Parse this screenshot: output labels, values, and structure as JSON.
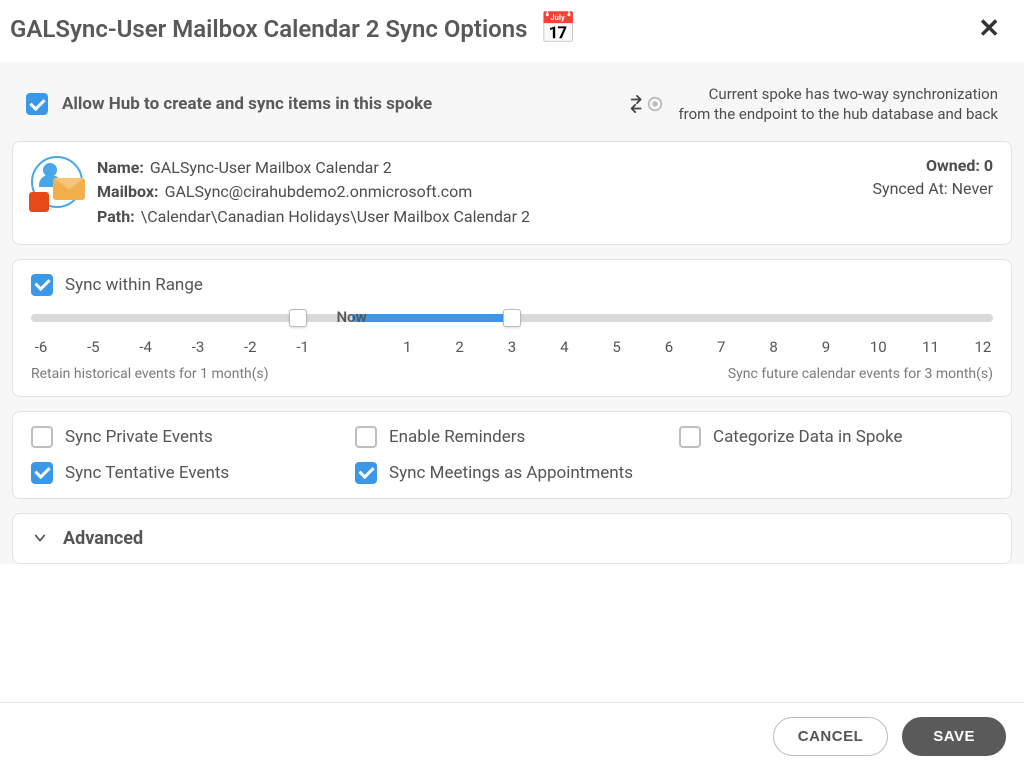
{
  "header": {
    "title": "GALSync-User Mailbox Calendar 2 Sync Options"
  },
  "allow": {
    "checked": true,
    "label": "Allow Hub to create and sync items in this spoke"
  },
  "sync_mode": {
    "desc_line1": "Current spoke has two-way synchronization",
    "desc_line2": "from the endpoint to the hub database and back"
  },
  "info": {
    "name_label": "Name:",
    "name_value": "GALSync-User Mailbox Calendar 2",
    "mailbox_label": "Mailbox:",
    "mailbox_value": "GALSync@cirahubdemo2.onmicrosoft.com",
    "path_label": "Path:",
    "path_value": "\\Calendar\\Canadian Holidays\\User Mailbox Calendar 2",
    "owned_label": "Owned:",
    "owned_value": "0",
    "synced_label": "Synced At:",
    "synced_value": "Never"
  },
  "range": {
    "checked": true,
    "title": "Sync within Range",
    "now_label": "Now",
    "min": -6,
    "max": 12,
    "low": -1,
    "high": 3,
    "ticks": [
      "-6",
      "-5",
      "-4",
      "-3",
      "-2",
      "-1",
      "",
      "1",
      "2",
      "3",
      "4",
      "5",
      "6",
      "7",
      "8",
      "9",
      "10",
      "11",
      "12"
    ],
    "retain_text": "Retain historical events for 1 month(s)",
    "future_text": "Sync future calendar events for 3 month(s)"
  },
  "options": {
    "sync_private": {
      "checked": false,
      "label": "Sync Private Events"
    },
    "enable_reminders": {
      "checked": false,
      "label": "Enable Reminders"
    },
    "categorize": {
      "checked": false,
      "label": "Categorize Data in Spoke"
    },
    "sync_tentative": {
      "checked": true,
      "label": "Sync Tentative Events"
    },
    "sync_meetings": {
      "checked": true,
      "label": "Sync Meetings as Appointments"
    }
  },
  "advanced": {
    "label": "Advanced"
  },
  "footer": {
    "cancel": "CANCEL",
    "save": "SAVE"
  }
}
